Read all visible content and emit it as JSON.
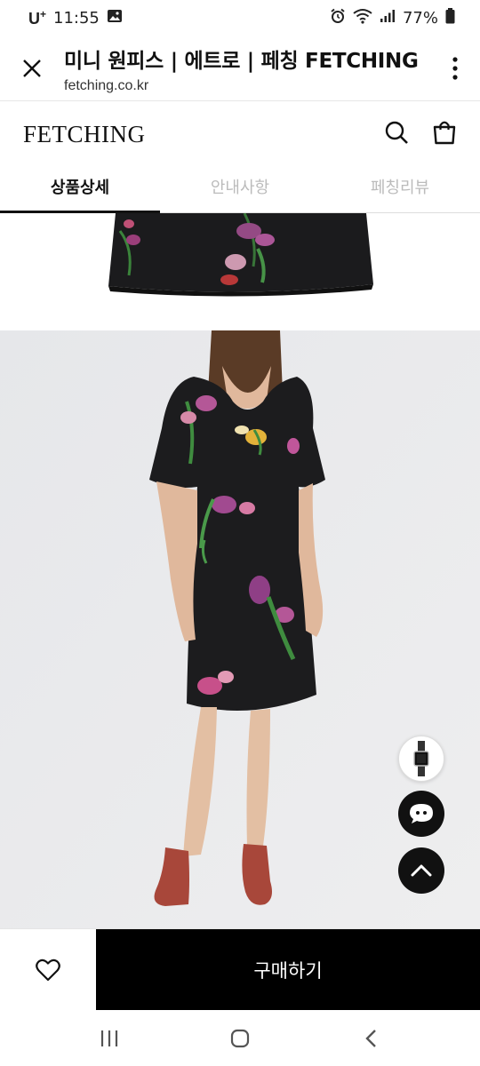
{
  "status_bar": {
    "carrier": "U",
    "carrier_plus": "+",
    "time": "11:55",
    "battery": "77%",
    "icons": [
      "gallery-icon",
      "alarm-icon",
      "wifi-icon",
      "signal-icon",
      "battery-icon"
    ]
  },
  "browser": {
    "title": "미니 원피스 | 에트로 | 페칭 FETCHING",
    "url": "fetching.co.kr",
    "close_icon": "close-icon",
    "more_icon": "more-vert-icon"
  },
  "site_header": {
    "logo": "FETCHING",
    "icons": [
      "search-icon",
      "shopping-bag-icon"
    ]
  },
  "tabs": [
    {
      "label": "상품상세",
      "active": true
    },
    {
      "label": "안내사항",
      "active": false
    },
    {
      "label": "페칭리뷰",
      "active": false
    }
  ],
  "floating_buttons": [
    "recent-product-thumbnail",
    "chat-icon",
    "scroll-top-icon"
  ],
  "purchase_bar": {
    "wish_icon": "heart-icon",
    "buy_label": "구매하기"
  },
  "nav_bar": [
    "recent-apps-icon",
    "home-icon",
    "back-icon"
  ],
  "colors": {
    "accent": "#000000",
    "tab_inactive": "#bbbbbb",
    "photo_background": "#e9e9ea",
    "dress": "#1c1c1e"
  }
}
